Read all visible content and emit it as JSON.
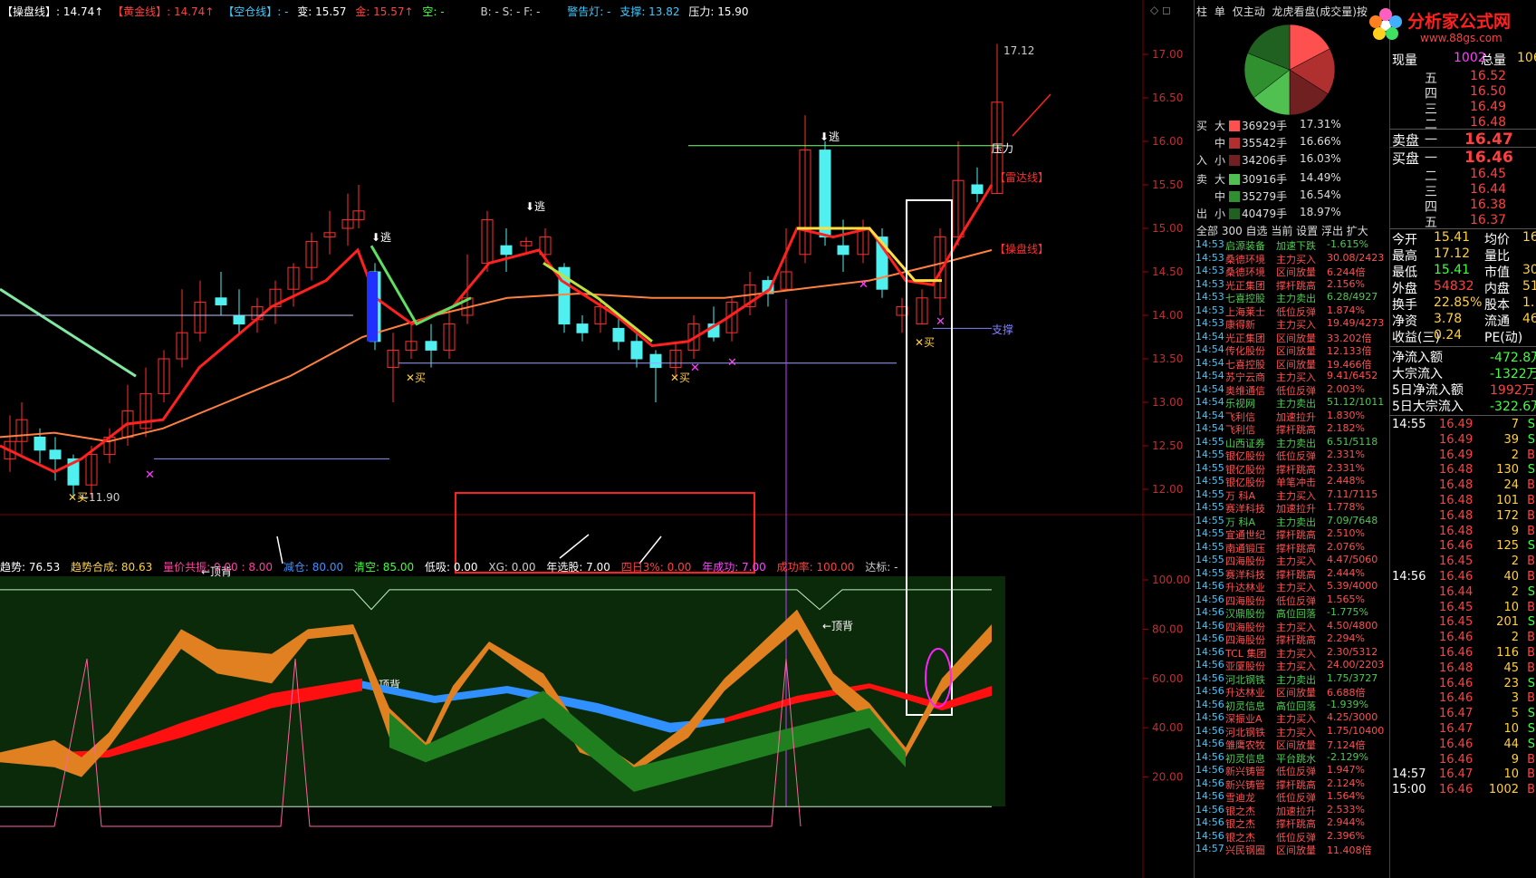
{
  "top_indicators": {
    "caozuo": "【操盘线】: 14.74↑",
    "huangjin": "【黄金线】: 14.74↑",
    "kongcang": "【空仓线】: -",
    "bian": "变: 15.57",
    "jin": "金: 15.57↑",
    "kong": "空: -",
    "bsf": "B: -  S: -  F: -",
    "warning": "警告灯: -",
    "support": "支撑: 13.82",
    "pressure": "压力: 15.90",
    "corner": "◇ ◻"
  },
  "price_axis": [
    "17.00",
    "16.50",
    "16.00",
    "15.50",
    "15.00",
    "14.50",
    "14.00",
    "13.50",
    "13.00",
    "12.50",
    "12.00"
  ],
  "sub_axis": [
    "100.00",
    "80.00",
    "60.00",
    "40.00",
    "20.00"
  ],
  "chart_labels": {
    "high": "17.12",
    "low": "←11.90",
    "escape": "逃",
    "buy": "买",
    "pressure": "压力",
    "support": "支撑",
    "radar": "【雷达线】",
    "caopan": "【操盘线】",
    "top_div": "←顶背"
  },
  "indicator_line": {
    "trend": "趋势: 76.53",
    "trend_comb": "趋势合成: 80.63",
    "volprice": "量价共振: 0.00 : 8.00",
    "reduce": "减仓: 80.00",
    "clear": "清空: 85.00",
    "lowbuy": "低吸: 0.00",
    "xg": "XG: 0.00",
    "year_pick": "年选股: 7.00",
    "four_day": "四日3%: 0.00",
    "year_success": "年成功: 7.00",
    "success_rate": "成功率: 100.00",
    "target": "达标: -"
  },
  "mid_panel": {
    "tabs": [
      "柱",
      "单",
      "仅主动",
      "龙虎看盘(成交量)按"
    ],
    "flows": [
      {
        "side": "买",
        "size": "大",
        "qty": "36929手",
        "pct": "17.31%",
        "color": "#ff5050"
      },
      {
        "side": "",
        "size": "中",
        "qty": "35542手",
        "pct": "16.66%",
        "color": "#b03030"
      },
      {
        "side": "入",
        "size": "小",
        "qty": "34206手",
        "pct": "16.03%",
        "color": "#702020"
      },
      {
        "side": "卖",
        "size": "大",
        "qty": "30916手",
        "pct": "14.49%",
        "color": "#50c050"
      },
      {
        "side": "",
        "size": "中",
        "qty": "35279手",
        "pct": "16.54%",
        "color": "#309030"
      },
      {
        "side": "出",
        "size": "小",
        "qty": "40479手",
        "pct": "18.97%",
        "color": "#206020"
      }
    ],
    "pie": [
      17.31,
      16.66,
      16.03,
      14.49,
      16.54,
      18.97
    ],
    "filter_bar": "全部  300  自选  当前  设置  浮出  扩大",
    "news": [
      [
        "14:53",
        "启源装备",
        "加速下跌",
        "-1.615%",
        "#50c850"
      ],
      [
        "14:53",
        "桑德环境",
        "主力买入",
        "30.08/2423",
        "#ff5050"
      ],
      [
        "14:53",
        "桑德环境",
        "区间放量",
        "6.244倍",
        "#ff5050"
      ],
      [
        "14:53",
        "光正集团",
        "撑杆跳高",
        "2.156%",
        "#ff5050"
      ],
      [
        "14:53",
        "七喜控股",
        "主力卖出",
        "6.28/4927",
        "#50c850"
      ],
      [
        "14:53",
        "上海莱士",
        "低位反弹",
        "1.874%",
        "#ff5050"
      ],
      [
        "14:53",
        "康得新",
        "主力买入",
        "19.49/4273",
        "#ff5050"
      ],
      [
        "14:54",
        "光正集团",
        "区间放量",
        "33.202倍",
        "#ff5050"
      ],
      [
        "14:54",
        "传化股份",
        "区间放量",
        "12.133倍",
        "#ff5050"
      ],
      [
        "14:54",
        "七喜控股",
        "区间放量",
        "19.466倍",
        "#ff5050"
      ],
      [
        "14:54",
        "苏宁云商",
        "主力买入",
        "9.41/6452",
        "#ff5050"
      ],
      [
        "14:54",
        "奥维通信",
        "低位反弹",
        "2.003%",
        "#ff5050"
      ],
      [
        "14:54",
        "乐视网",
        "主力卖出",
        "51.12/1011",
        "#50c850"
      ],
      [
        "14:54",
        "飞利信",
        "加速拉升",
        "1.830%",
        "#ff5050"
      ],
      [
        "14:54",
        "飞利信",
        "撑杆跳高",
        "2.182%",
        "#ff5050"
      ],
      [
        "14:55",
        "山西证券",
        "主力卖出",
        "6.51/5118",
        "#50c850"
      ],
      [
        "14:55",
        "银亿股份",
        "低位反弹",
        "2.331%",
        "#ff5050"
      ],
      [
        "14:55",
        "银亿股份",
        "撑杆跳高",
        "2.331%",
        "#ff5050"
      ],
      [
        "14:55",
        "银亿股份",
        "单笔冲击",
        "2.448%",
        "#ff5050"
      ],
      [
        "14:55",
        "万  科A",
        "主力买入",
        "7.11/7115",
        "#ff5050"
      ],
      [
        "14:55",
        "赛洋科技",
        "加速拉升",
        "1.778%",
        "#ff5050"
      ],
      [
        "14:55",
        "万  科A",
        "主力卖出",
        "7.09/7648",
        "#50c850"
      ],
      [
        "14:55",
        "宜通世纪",
        "撑杆跳高",
        "2.510%",
        "#ff5050"
      ],
      [
        "14:55",
        "南通锻压",
        "撑杆跳高",
        "2.076%",
        "#ff5050"
      ],
      [
        "14:55",
        "四海股份",
        "主力买入",
        "4.47/5060",
        "#ff5050"
      ],
      [
        "14:55",
        "赛洋科技",
        "撑杆跳高",
        "2.444%",
        "#ff5050"
      ],
      [
        "14:56",
        "升达林业",
        "主力买入",
        "5.39/4000",
        "#ff5050"
      ],
      [
        "14:56",
        "四海股份",
        "低位反弹",
        "1.565%",
        "#ff5050"
      ],
      [
        "14:56",
        "汉鼎股份",
        "高位回落",
        "-1.775%",
        "#50c850"
      ],
      [
        "14:56",
        "四海股份",
        "主力买入",
        "4.50/4800",
        "#ff5050"
      ],
      [
        "14:56",
        "四海股份",
        "撑杆跳高",
        "2.294%",
        "#ff5050"
      ],
      [
        "14:56",
        "TCL 集团",
        "主力买入",
        "2.30/5312",
        "#ff5050"
      ],
      [
        "14:56",
        "亚厦股份",
        "主力买入",
        "24.00/2203",
        "#ff5050"
      ],
      [
        "14:56",
        "河北钢铁",
        "主力卖出",
        "1.75/3727",
        "#50c850"
      ],
      [
        "14:56",
        "升达林业",
        "区间放量",
        "6.688倍",
        "#ff5050"
      ],
      [
        "14:56",
        "初灵信息",
        "高位回落",
        "-1.939%",
        "#50c850"
      ],
      [
        "14:56",
        "深振业A",
        "主力买入",
        "4.25/3000",
        "#ff5050"
      ],
      [
        "14:56",
        "河北钢铁",
        "主力买入",
        "1.75/10400",
        "#ff5050"
      ],
      [
        "14:56",
        "雏鹰农牧",
        "区间放量",
        "7.124倍",
        "#ff5050"
      ],
      [
        "14:56",
        "初灵信息",
        "平台跳水",
        "-2.129%",
        "#50c850"
      ],
      [
        "14:56",
        "新兴铸管",
        "低位反弹",
        "1.947%",
        "#ff5050"
      ],
      [
        "14:56",
        "新兴铸管",
        "撑杆跳高",
        "2.124%",
        "#ff5050"
      ],
      [
        "14:56",
        "雪迪龙",
        "低位反弹",
        "1.564%",
        "#ff5050"
      ],
      [
        "14:56",
        "银之杰",
        "加速拉升",
        "2.533%",
        "#ff5050"
      ],
      [
        "14:56",
        "银之杰",
        "撑杆跳高",
        "2.944%",
        "#ff5050"
      ],
      [
        "14:56",
        "银之杰",
        "低位反弹",
        "2.396%",
        "#ff5050"
      ],
      [
        "14:57",
        "兴民钢圈",
        "区间放量",
        "11.408倍",
        "#ff5050"
      ]
    ]
  },
  "right_panel": {
    "logo_text": "分析家公式网",
    "logo_url": "www.88gs.com",
    "now_label": "现量",
    "now_val": "1002",
    "total_label": "总量",
    "total_val": "106",
    "asks": [
      [
        "五",
        "16.52"
      ],
      [
        "四",
        "16.50"
      ],
      [
        "三",
        "16.49"
      ],
      [
        "二",
        "16.48"
      ]
    ],
    "sell_label": "卖盘",
    "sell_one": "一",
    "sell_price": "16.47",
    "buy_label": "买盘",
    "buy_one": "一",
    "buy_price": "16.46",
    "bids": [
      [
        "二",
        "16.45"
      ],
      [
        "三",
        "16.44"
      ],
      [
        "四",
        "16.38"
      ],
      [
        "五",
        "16.37"
      ]
    ],
    "stats": [
      [
        "今开",
        "15.41",
        "均价",
        "16."
      ],
      [
        "最高",
        "17.12",
        "量比",
        ""
      ],
      [
        "最低",
        "15.41",
        "市值",
        "30"
      ],
      [
        "外盘",
        "54832",
        "内盘",
        "51"
      ],
      [
        "换手",
        "22.85%",
        "股本",
        "1."
      ],
      [
        "净资",
        "3.78",
        "流通",
        "46"
      ],
      [
        "收益(三)",
        "0.24",
        "PE(动)",
        ""
      ]
    ],
    "flows": [
      [
        "净流入额",
        "-472.8万"
      ],
      [
        "大宗流入",
        "-1322万"
      ],
      [
        "5日净流入额",
        "1992万"
      ],
      [
        "5日大宗流入",
        "-322.6万"
      ]
    ],
    "ticks": [
      [
        "14:55",
        "16.49",
        "7",
        "S"
      ],
      [
        "",
        "16.49",
        "39",
        "S"
      ],
      [
        "",
        "16.49",
        "2",
        "B"
      ],
      [
        "",
        "16.48",
        "130",
        "S"
      ],
      [
        "",
        "16.48",
        "24",
        "B"
      ],
      [
        "",
        "16.48",
        "101",
        "B"
      ],
      [
        "",
        "16.48",
        "172",
        "B"
      ],
      [
        "",
        "16.48",
        "9",
        "B"
      ],
      [
        "",
        "16.46",
        "125",
        "S"
      ],
      [
        "",
        "16.45",
        "2",
        "B"
      ],
      [
        "14:56",
        "16.46",
        "40",
        "B"
      ],
      [
        "",
        "16.44",
        "2",
        "S"
      ],
      [
        "",
        "16.45",
        "10",
        "B"
      ],
      [
        "",
        "16.45",
        "201",
        "S"
      ],
      [
        "",
        "16.46",
        "2",
        "B"
      ],
      [
        "",
        "16.46",
        "116",
        "B"
      ],
      [
        "",
        "16.48",
        "45",
        "B"
      ],
      [
        "",
        "16.46",
        "23",
        "S"
      ],
      [
        "",
        "16.46",
        "3",
        "B"
      ],
      [
        "",
        "16.47",
        "5",
        "S"
      ],
      [
        "",
        "16.47",
        "10",
        "S"
      ],
      [
        "",
        "16.46",
        "44",
        "S"
      ],
      [
        "",
        "16.46",
        "9",
        "B"
      ],
      [
        "14:57",
        "16.47",
        "10",
        "B"
      ],
      [
        "15:00",
        "16.46",
        "1002",
        "B"
      ]
    ]
  }
}
